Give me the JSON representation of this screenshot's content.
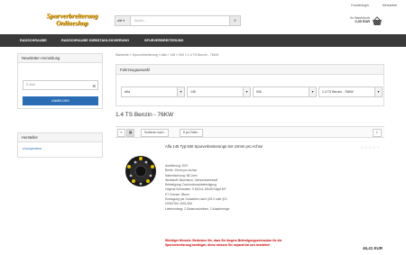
{
  "header": {
    "logo": [
      "Spurverbreiterung",
      "Onlineshop"
    ],
    "links": {
      "account": "Kundenlogin",
      "wishlist": "Merkzettel"
    },
    "search": {
      "category": "alle",
      "placeholder": "Suche..."
    },
    "cart": {
      "label": "Ihr Warenkorb",
      "amount": "0,00 EUR"
    }
  },
  "nav": [
    "RADSCHRAUBE",
    "RADSCHRAUBE DIEBSTAHLSICHERUNG",
    "SPURVERBREITERUNG"
  ],
  "sidebar": {
    "newsletter": {
      "title": "Newsletter-Anmeldung",
      "email_placeholder": "E-Mail",
      "subscribe": "ANMELDEN"
    },
    "manufacturer": {
      "title": "Hersteller",
      "item": "sl suspension"
    }
  },
  "breadcrumb": "Startseite  »  Spurverbreiterung  »  Alfa  »  145  »  930  »  1.4 TS Benzin - 76KW",
  "fahrzeug": {
    "title": "Fahrzeugauswahl",
    "selects": [
      "Alfa",
      "145",
      "930",
      "1.4 TS Benzin - 76KW"
    ]
  },
  "page_title": "1.4 TS Benzin - 76KW",
  "toolbar": {
    "sort": "Sortieren nach -",
    "per_page": "8 pro Seite -",
    "page": "1"
  },
  "product": {
    "name": "Alfa 145 Typ:930 Spurverbreiterungs Set 10mm pro Achse",
    "details": [
      "Ausführung: DZX",
      "Breite: 10mm pro Achse",
      "Nabenbohrung: 58,1mm",
      "Werkstoff: Aluminium, Verbundwerkstoff",
      "Befestigung: Durchschraubbefestigung",
      "Original Schrauben: 5 M12x1,25x35 Kegel 60°",
      "ET Grenze: 28mm",
      "Eintragung per Gutachten nach §19.3 oder §21",
      "HSN/TSN: 4001/150",
      "Lieferumfang: 2 Distanzscheiben, 2 Adapterringe"
    ],
    "warning": "Wichtiger Hinweis: Bedenken Sie, dass Sie längere Befestigungsschrauben für die Spurverbreiterung benötigen, diese müssen Sie separat bei uns bestellen!",
    "stars": "☆☆☆☆☆",
    "price": "46,41 EUR"
  },
  "colors": {
    "nav": "#3a3a3a",
    "button": "#2a6db5",
    "warning": "#cc0000",
    "logo": "#e8a300"
  }
}
